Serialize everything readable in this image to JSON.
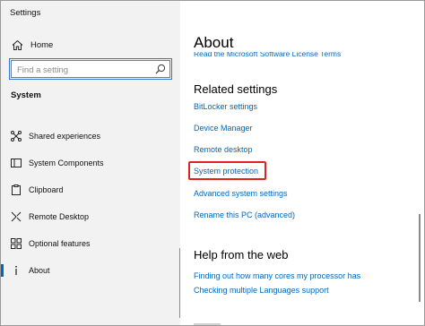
{
  "window": {
    "title": "Settings"
  },
  "title_controls": {
    "minimize": "minimize-icon",
    "maximize": "maximize-icon",
    "close": "close-icon"
  },
  "sidebar": {
    "home_label": "Home",
    "search": {
      "placeholder": "Find a setting",
      "value": ""
    },
    "section_label": "System",
    "items": [
      {
        "label": "Shared experiences",
        "icon": "shared-experiences-icon",
        "selected": false
      },
      {
        "label": "System Components",
        "icon": "system-components-icon",
        "selected": false
      },
      {
        "label": "Clipboard",
        "icon": "clipboard-icon",
        "selected": false
      },
      {
        "label": "Remote Desktop",
        "icon": "remote-desktop-icon",
        "selected": false
      },
      {
        "label": "Optional features",
        "icon": "optional-features-icon",
        "selected": false
      },
      {
        "label": "About",
        "icon": "about-icon",
        "selected": true
      }
    ]
  },
  "main": {
    "title": "About",
    "clipped_link": "Read the Microsoft Software License Terms",
    "related": {
      "title": "Related settings",
      "links": [
        "BitLocker settings",
        "Device Manager",
        "Remote desktop",
        "System protection",
        "Advanced system settings",
        "Rename this PC (advanced)"
      ]
    },
    "help": {
      "title": "Help from the web",
      "links": [
        "Finding out how many cores my processor has",
        "Checking multiple Languages support"
      ]
    }
  },
  "colors": {
    "accent": "#0067c0",
    "highlight": "#e0241d",
    "sidebar_bg": "#f2f2f2"
  }
}
